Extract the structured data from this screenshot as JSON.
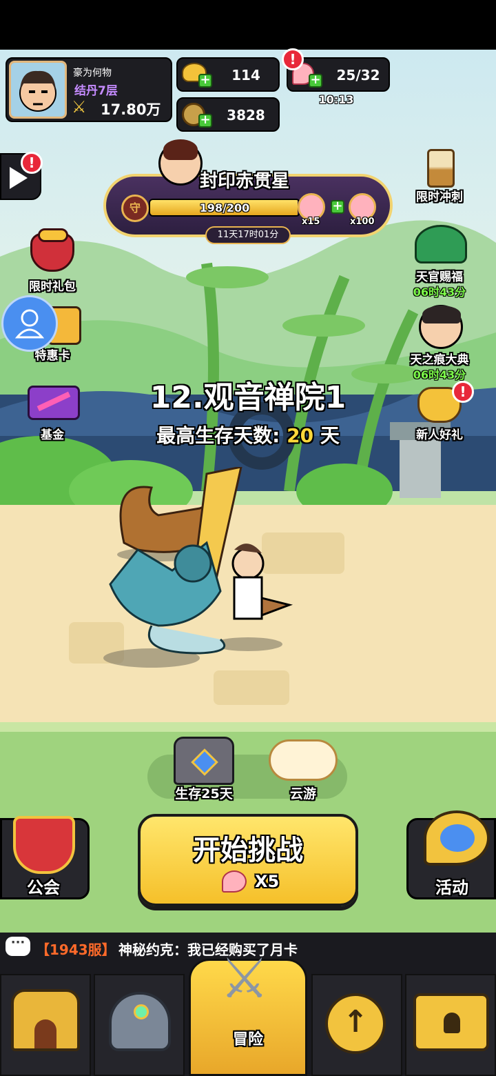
{
  "player": {
    "name": "豪为何物",
    "rank": "结丹7层",
    "power": "17.80万"
  },
  "currency": {
    "gold": "114",
    "coins": "3828",
    "stamina": "25/32",
    "stamina_timer": "10:13"
  },
  "event_banner": {
    "title": "封印赤贯星",
    "progress": "198/200",
    "progress_fraction": 0.99,
    "reward1_qty": "x15",
    "reward2_qty": "x100",
    "time_left": "11天17时01分"
  },
  "left_menu": [
    {
      "label": "限时礼包"
    },
    {
      "label": "特惠卡"
    },
    {
      "label": "基金"
    }
  ],
  "right_menu": [
    {
      "label": "限时冲刺"
    },
    {
      "label": "天官赐福",
      "timer": "06时43分"
    },
    {
      "label": "天之痕大典",
      "timer": "06时43分"
    },
    {
      "label": "新人好礼"
    }
  ],
  "stage": {
    "name": "12.观音禅院1",
    "survival_label": "最高生存天数:",
    "survival_days": "20",
    "days_unit": "天"
  },
  "actions": {
    "chest_label": "生存25天",
    "cloud_label": "云游",
    "start_label": "开始挑战",
    "start_cost": "X5",
    "guild_label": "公会",
    "activity_label": "活动"
  },
  "chat": {
    "server": "【1943服】",
    "message": "神秘约克：我已经购买了月卡"
  },
  "tabs": [
    {
      "label": ""
    },
    {
      "label": ""
    },
    {
      "label": "冒险"
    },
    {
      "label": ""
    },
    {
      "label": ""
    }
  ]
}
